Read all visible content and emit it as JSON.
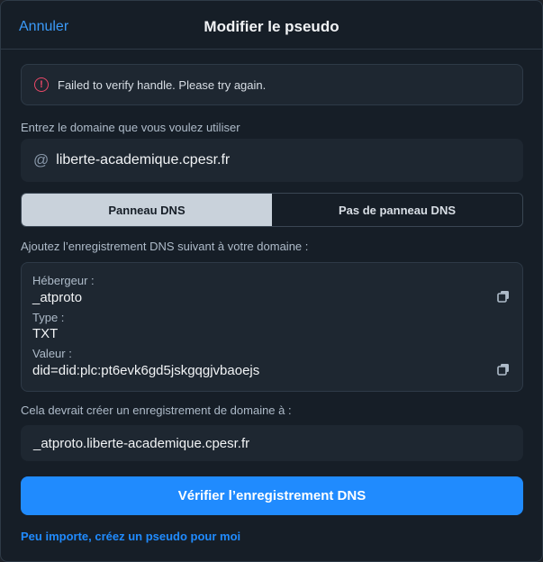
{
  "header": {
    "cancel_label": "Annuler",
    "title": "Modifier le pseudo"
  },
  "error": {
    "icon": "!",
    "message": "Failed to verify handle. Please try again."
  },
  "domain": {
    "label": "Entrez le domaine que vous voulez utiliser",
    "at_symbol": "@",
    "value": "liberte-academique.cpesr.fr"
  },
  "tabs": {
    "dns_panel": "Panneau DNS",
    "no_dns_panel": "Pas de panneau DNS"
  },
  "dns": {
    "instruction": "Ajoutez l’enregistrement DNS suivant à votre domaine :",
    "host_label": "Hébergeur :",
    "host_value": "_atproto",
    "type_label": "Type :",
    "type_value": "TXT",
    "value_label": "Valeur :",
    "value_value": "did=did:plc:pt6evk6gd5jskgqgjvbaoejs"
  },
  "result": {
    "label": "Cela devrait créer un enregistrement de domaine à :",
    "value": "_atproto.liberte-academique.cpesr.fr"
  },
  "actions": {
    "verify_label": "Vérifier l’enregistrement DNS",
    "generate_link": "Peu importe, créez un pseudo pour moi"
  },
  "colors": {
    "accent": "#208bfe",
    "error": "#ec4868",
    "background": "#161e27"
  }
}
